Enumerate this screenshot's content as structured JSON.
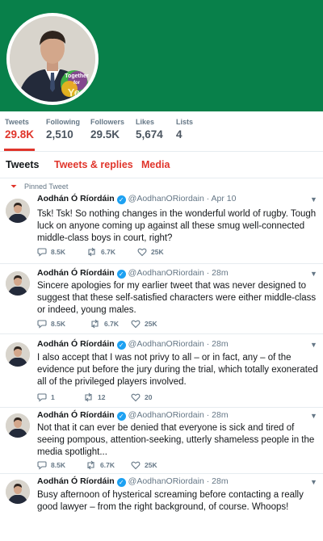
{
  "colors": {
    "banner": "#08804a",
    "accent": "#e0352b",
    "verified": "#1da1f2"
  },
  "avatar_badge": {
    "line1": "Together",
    "line2": "for",
    "line3": "Yes"
  },
  "stats": [
    {
      "label": "Tweets",
      "value": "29.8K"
    },
    {
      "label": "Following",
      "value": "2,510"
    },
    {
      "label": "Followers",
      "value": "29.5K"
    },
    {
      "label": "Likes",
      "value": "5,674"
    },
    {
      "label": "Lists",
      "value": "4"
    }
  ],
  "tabs": [
    "Tweets",
    "Tweets & replies",
    "Media"
  ],
  "pinned_label": "Pinned Tweet",
  "tweets": [
    {
      "name": "Aodhán Ó Ríordáin",
      "handle": "@AodhanORiordain · Apr 10",
      "text": "Tsk! Tsk! So nothing changes in the wonderful world of rugby. Tough luck on anyone coming up against all these smug well-connected middle-class boys in court, right?",
      "replies": "8.5K",
      "retweets": "6.7K",
      "likes": "25K"
    },
    {
      "name": "Aodhán Ó Ríordáin",
      "handle": "@AodhanORiordain · 28m",
      "text": "Sincere apologies for my earlier tweet that was never designed to suggest that these self-satisfied characters were either middle-class or indeed, young males.",
      "replies": "8.5K",
      "retweets": "6.7K",
      "likes": "25K"
    },
    {
      "name": "Aodhán Ó Ríordáin",
      "handle": "@AodhanORiordain · 28m",
      "text": "I also accept that I was not privy to all – or in fact, any – of the evidence put before the jury during the trial, which totally exonerated all of the privileged players involved.",
      "replies": "1",
      "retweets": "12",
      "likes": "20"
    },
    {
      "name": "Aodhán Ó Ríordáin",
      "handle": "@AodhanORiordain · 28m",
      "text": "Not that it can ever be denied that everyone is sick and tired of seeing pompous, attention-seeking, utterly shameless people in the media spotlight...",
      "replies": "8.5K",
      "retweets": "6.7K",
      "likes": "25K"
    },
    {
      "name": "Aodhán Ó Ríordáin",
      "handle": "@AodhanORiordain · 28m",
      "text": "Busy afternoon of hysterical screaming before contacting a really good lawyer – from the right background, of course. Whoops!"
    }
  ]
}
